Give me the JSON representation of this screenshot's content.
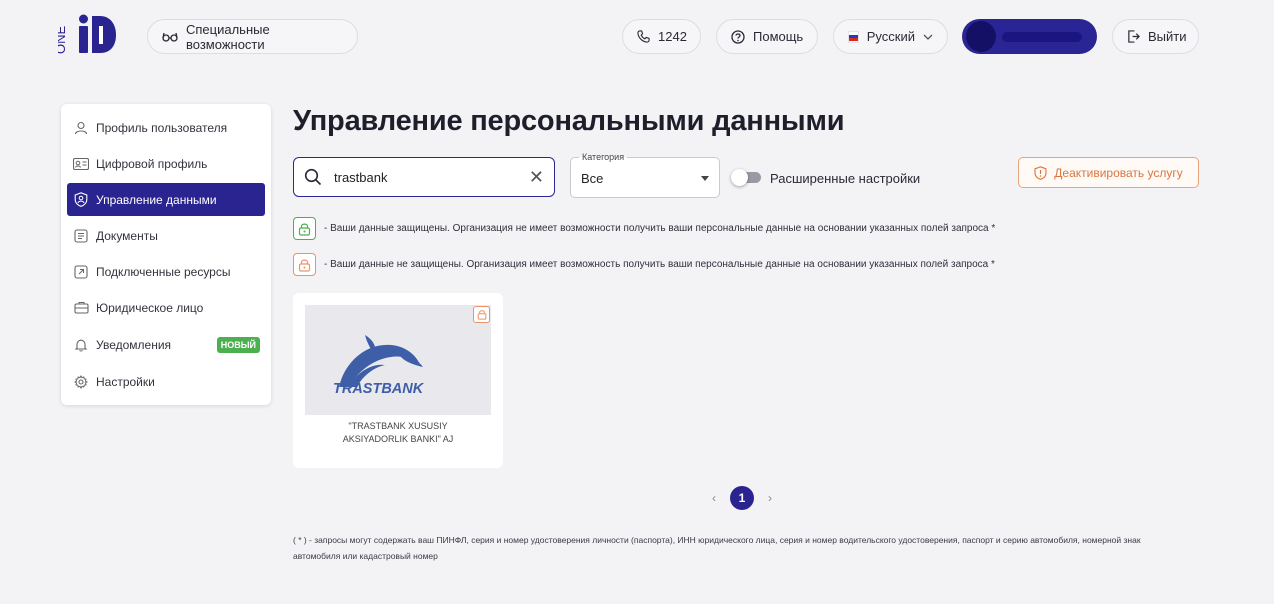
{
  "header": {
    "logo_text": "ONE",
    "accessibility_label": "Специальные возможности",
    "phone_label": "1242",
    "help_label": "Помощь",
    "language_label": "Русский",
    "logout_label": "Выйти",
    "colors": {
      "brand": "#29248f",
      "accent_orange": "#d9763e",
      "green": "#4caf50"
    }
  },
  "sidebar": {
    "items": [
      {
        "label": "Профиль пользователя",
        "icon": "user-icon"
      },
      {
        "label": "Цифровой профиль",
        "icon": "id-card-icon"
      },
      {
        "label": "Управление данными",
        "icon": "shield-user-icon",
        "active": true
      },
      {
        "label": "Документы",
        "icon": "document-icon"
      },
      {
        "label": "Подключенные ресурсы",
        "icon": "link-out-icon"
      },
      {
        "label": "Юридическое лицо",
        "icon": "briefcase-icon"
      },
      {
        "label": "Уведомления",
        "icon": "bell-icon",
        "badge": "НОВЫЙ"
      },
      {
        "label": "Настройки",
        "icon": "gear-icon"
      }
    ]
  },
  "main": {
    "title": "Управление персональными данными",
    "search": {
      "value": "trastbank"
    },
    "category": {
      "label": "Категория",
      "value": "Все"
    },
    "advanced_settings_label": "Расширенные настройки",
    "deactivate_label": "Деактивировать услугу",
    "legend_protected": "- Ваши данные защищены. Организация не имеет возможности получить ваши персональные данные на основании указанных полей запроса *",
    "legend_unprotected": "- Ваши данные не защищены. Организация имеет возможность получить ваши персональные данные на основании указанных полей запроса *",
    "cards": [
      {
        "logo_text": "TRASTBANK",
        "name_line1": "\"TRASTBANK XUSUSIY",
        "name_line2": "AKSIYADORLIK BANKI\" AJ"
      }
    ],
    "pagination": {
      "current": "1",
      "prev": "‹",
      "next": "›"
    },
    "footnote": "( * ) - запросы могут содержать ваш ПИНФЛ, серия и номер удостоверения личности (паспорта), ИНН юридического лица, серия и номер водительского удостоверения, паспорт и серию автомобиля, номерной знак автомобиля или кадастровый номер"
  }
}
